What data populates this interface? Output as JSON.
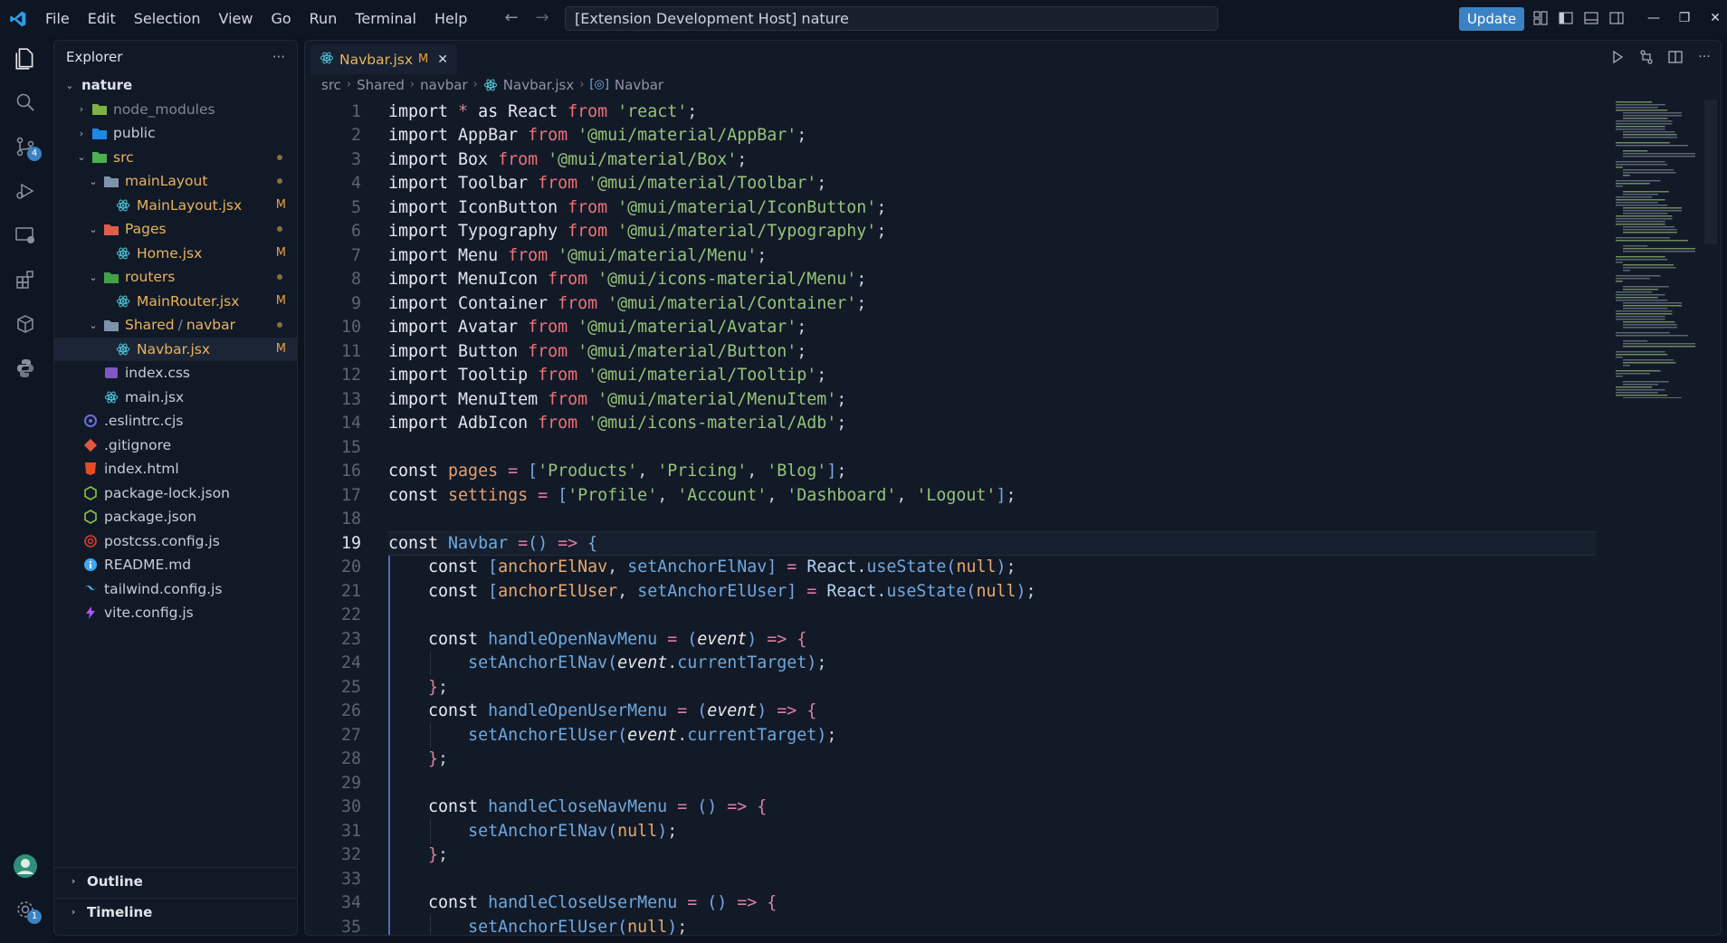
{
  "menu": [
    "File",
    "Edit",
    "Selection",
    "View",
    "Go",
    "Run",
    "Terminal",
    "Help"
  ],
  "command_center": "[Extension Development Host] nature",
  "update_label": "Update",
  "activity": {
    "source_control_badge": "4",
    "settings_badge": "1"
  },
  "explorer": {
    "title": "Explorer",
    "more": "···",
    "root": "nature",
    "items": [
      {
        "label": "node_modules",
        "depth": 1,
        "kind": "folder",
        "state": "collapsed",
        "color": "dim",
        "icon": "node-folder-icon"
      },
      {
        "label": "public",
        "depth": 1,
        "kind": "folder",
        "state": "collapsed",
        "color": "norm",
        "icon": "public-folder-icon"
      },
      {
        "label": "src",
        "depth": 1,
        "kind": "folder",
        "state": "expanded",
        "color": "mod",
        "icon": "src-folder-icon",
        "dot": true
      },
      {
        "label": "mainLayout",
        "depth": 2,
        "kind": "folder",
        "state": "expanded",
        "color": "mod",
        "icon": "folder-icon",
        "dot": true
      },
      {
        "label": "MainLayout.jsx",
        "depth": 3,
        "kind": "file",
        "color": "mod",
        "icon": "react-icon",
        "git": "M"
      },
      {
        "label": "Pages",
        "depth": 2,
        "kind": "folder",
        "state": "expanded",
        "color": "mod",
        "icon": "pages-folder-icon",
        "dot": true
      },
      {
        "label": "Home.jsx",
        "depth": 3,
        "kind": "file",
        "color": "mod",
        "icon": "react-icon",
        "git": "M"
      },
      {
        "label": "routers",
        "depth": 2,
        "kind": "folder",
        "state": "expanded",
        "color": "mod",
        "icon": "routers-folder-icon",
        "dot": true
      },
      {
        "label": "MainRouter.jsx",
        "depth": 3,
        "kind": "file",
        "color": "mod",
        "icon": "react-icon",
        "git": "M"
      },
      {
        "label": "Shared",
        "label2": "navbar",
        "depth": 2,
        "kind": "folder",
        "state": "expanded",
        "color": "mod",
        "icon": "folder-icon",
        "dot": true
      },
      {
        "label": "Navbar.jsx",
        "depth": 3,
        "kind": "file",
        "color": "mod",
        "icon": "react-icon",
        "git": "M",
        "selected": true
      },
      {
        "label": "index.css",
        "depth": 2,
        "kind": "file",
        "color": "norm",
        "icon": "css-icon"
      },
      {
        "label": "main.jsx",
        "depth": 2,
        "kind": "file",
        "color": "norm",
        "icon": "react-icon"
      },
      {
        "label": ".eslintrc.cjs",
        "depth": 1,
        "kind": "file",
        "color": "norm",
        "icon": "eslint-icon"
      },
      {
        "label": ".gitignore",
        "depth": 1,
        "kind": "file",
        "color": "norm",
        "icon": "git-icon"
      },
      {
        "label": "index.html",
        "depth": 1,
        "kind": "file",
        "color": "norm",
        "icon": "html-icon"
      },
      {
        "label": "package-lock.json",
        "depth": 1,
        "kind": "file",
        "color": "norm",
        "icon": "npm-icon"
      },
      {
        "label": "package.json",
        "depth": 1,
        "kind": "file",
        "color": "norm",
        "icon": "npm-icon"
      },
      {
        "label": "postcss.config.js",
        "depth": 1,
        "kind": "file",
        "color": "norm",
        "icon": "postcss-icon"
      },
      {
        "label": "README.md",
        "depth": 1,
        "kind": "file",
        "color": "norm",
        "icon": "info-icon"
      },
      {
        "label": "tailwind.config.js",
        "depth": 1,
        "kind": "file",
        "color": "norm",
        "icon": "tailwind-icon"
      },
      {
        "label": "vite.config.js",
        "depth": 1,
        "kind": "file",
        "color": "norm",
        "icon": "vite-icon"
      }
    ],
    "outline": "Outline",
    "timeline": "Timeline"
  },
  "tab": {
    "label": "Navbar.jsx",
    "status": "M"
  },
  "breadcrumbs": [
    "src",
    "Shared",
    "navbar",
    "Navbar.jsx",
    "Navbar"
  ],
  "active_line": 19,
  "code_lines": [
    [
      [
        "kw2",
        "import "
      ],
      [
        "op",
        "* "
      ],
      [
        "kw2",
        "as "
      ],
      [
        "id",
        "React "
      ],
      [
        "kw",
        "from "
      ],
      [
        "str",
        "'react'"
      ],
      [
        "pun",
        ";"
      ]
    ],
    [
      [
        "kw2",
        "import "
      ],
      [
        "id",
        "AppBar "
      ],
      [
        "kw",
        "from "
      ],
      [
        "str",
        "'@mui/material/AppBar'"
      ],
      [
        "pun",
        ";"
      ]
    ],
    [
      [
        "kw2",
        "import "
      ],
      [
        "id",
        "Box "
      ],
      [
        "kw",
        "from "
      ],
      [
        "str",
        "'@mui/material/Box'"
      ],
      [
        "pun",
        ";"
      ]
    ],
    [
      [
        "kw2",
        "import "
      ],
      [
        "id",
        "Toolbar "
      ],
      [
        "kw",
        "from "
      ],
      [
        "str",
        "'@mui/material/Toolbar'"
      ],
      [
        "pun",
        ";"
      ]
    ],
    [
      [
        "kw2",
        "import "
      ],
      [
        "id",
        "IconButton "
      ],
      [
        "kw",
        "from "
      ],
      [
        "str",
        "'@mui/material/IconButton'"
      ],
      [
        "pun",
        ";"
      ]
    ],
    [
      [
        "kw2",
        "import "
      ],
      [
        "id",
        "Typography "
      ],
      [
        "kw",
        "from "
      ],
      [
        "str",
        "'@mui/material/Typography'"
      ],
      [
        "pun",
        ";"
      ]
    ],
    [
      [
        "kw2",
        "import "
      ],
      [
        "id",
        "Menu "
      ],
      [
        "kw",
        "from "
      ],
      [
        "str",
        "'@mui/material/Menu'"
      ],
      [
        "pun",
        ";"
      ]
    ],
    [
      [
        "kw2",
        "import "
      ],
      [
        "id",
        "MenuIcon "
      ],
      [
        "kw",
        "from "
      ],
      [
        "str",
        "'@mui/icons-material/Menu'"
      ],
      [
        "pun",
        ";"
      ]
    ],
    [
      [
        "kw2",
        "import "
      ],
      [
        "id",
        "Container "
      ],
      [
        "kw",
        "from "
      ],
      [
        "str",
        "'@mui/material/Container'"
      ],
      [
        "pun",
        ";"
      ]
    ],
    [
      [
        "kw2",
        "import "
      ],
      [
        "id",
        "Avatar "
      ],
      [
        "kw",
        "from "
      ],
      [
        "str",
        "'@mui/material/Avatar'"
      ],
      [
        "pun",
        ";"
      ]
    ],
    [
      [
        "kw2",
        "import "
      ],
      [
        "id",
        "Button "
      ],
      [
        "kw",
        "from "
      ],
      [
        "str",
        "'@mui/material/Button'"
      ],
      [
        "pun",
        ";"
      ]
    ],
    [
      [
        "kw2",
        "import "
      ],
      [
        "id",
        "Tooltip "
      ],
      [
        "kw",
        "from "
      ],
      [
        "str",
        "'@mui/material/Tooltip'"
      ],
      [
        "pun",
        ";"
      ]
    ],
    [
      [
        "kw2",
        "import "
      ],
      [
        "id",
        "MenuItem "
      ],
      [
        "kw",
        "from "
      ],
      [
        "str",
        "'@mui/material/MenuItem'"
      ],
      [
        "pun",
        ";"
      ]
    ],
    [
      [
        "kw2",
        "import "
      ],
      [
        "id",
        "AdbIcon "
      ],
      [
        "kw",
        "from "
      ],
      [
        "str",
        "'@mui/icons-material/Adb'"
      ],
      [
        "pun",
        ";"
      ]
    ],
    [],
    [
      [
        "kw2",
        "const "
      ],
      [
        "cst",
        "pages "
      ],
      [
        "op",
        "= "
      ],
      [
        "br",
        "["
      ],
      [
        "str",
        "'Products'"
      ],
      [
        "pun",
        ", "
      ],
      [
        "str",
        "'Pricing'"
      ],
      [
        "pun",
        ", "
      ],
      [
        "str",
        "'Blog'"
      ],
      [
        "br",
        "]"
      ],
      [
        "pun",
        ";"
      ]
    ],
    [
      [
        "kw2",
        "const "
      ],
      [
        "cst",
        "settings "
      ],
      [
        "op",
        "= "
      ],
      [
        "br",
        "["
      ],
      [
        "str",
        "'Profile'"
      ],
      [
        "pun",
        ", "
      ],
      [
        "str",
        "'Account'"
      ],
      [
        "pun",
        ", "
      ],
      [
        "str",
        "'Dashboard'"
      ],
      [
        "pun",
        ", "
      ],
      [
        "str",
        "'Logout'"
      ],
      [
        "br",
        "]"
      ],
      [
        "pun",
        ";"
      ]
    ],
    [],
    [
      [
        "kw2",
        "const "
      ],
      [
        "fn",
        "Navbar "
      ],
      [
        "op",
        "="
      ],
      [
        "br",
        "() "
      ],
      [
        "op",
        "=> "
      ],
      [
        "br",
        "{"
      ]
    ],
    [
      [
        "pun",
        "    "
      ],
      [
        "kw2",
        "const "
      ],
      [
        "br",
        "["
      ],
      [
        "var",
        "anchorElNav"
      ],
      [
        "pun",
        ", "
      ],
      [
        "fn",
        "setAnchorElNav"
      ],
      [
        "br",
        "] "
      ],
      [
        "op",
        "= "
      ],
      [
        "react",
        "React"
      ],
      [
        "pun",
        "."
      ],
      [
        "fn",
        "useState"
      ],
      [
        "br",
        "("
      ],
      [
        "null",
        "null"
      ],
      [
        "br",
        ")"
      ],
      [
        "pun",
        ";"
      ]
    ],
    [
      [
        "pun",
        "    "
      ],
      [
        "kw2",
        "const "
      ],
      [
        "br",
        "["
      ],
      [
        "var",
        "anchorElUser"
      ],
      [
        "pun",
        ", "
      ],
      [
        "fn",
        "setAnchorElUser"
      ],
      [
        "br",
        "] "
      ],
      [
        "op",
        "= "
      ],
      [
        "react",
        "React"
      ],
      [
        "pun",
        "."
      ],
      [
        "fn",
        "useState"
      ],
      [
        "br",
        "("
      ],
      [
        "null",
        "null"
      ],
      [
        "br",
        ")"
      ],
      [
        "pun",
        ";"
      ]
    ],
    [],
    [
      [
        "pun",
        "    "
      ],
      [
        "kw2",
        "const "
      ],
      [
        "fn",
        "handleOpenNavMenu "
      ],
      [
        "op",
        "= "
      ],
      [
        "br",
        "("
      ],
      [
        "param",
        "event"
      ],
      [
        "br",
        ") "
      ],
      [
        "op",
        "=> "
      ],
      [
        "op",
        "{"
      ]
    ],
    [
      [
        "pun",
        "        "
      ],
      [
        "fn",
        "setAnchorElNav"
      ],
      [
        "br",
        "("
      ],
      [
        "param",
        "event"
      ],
      [
        "pun",
        "."
      ],
      [
        "fn",
        "currentTarget"
      ],
      [
        "br",
        ")"
      ],
      [
        "pun",
        ";"
      ]
    ],
    [
      [
        "pun",
        "    "
      ],
      [
        "op",
        "}"
      ],
      [
        "pun",
        ";"
      ]
    ],
    [
      [
        "pun",
        "    "
      ],
      [
        "kw2",
        "const "
      ],
      [
        "fn",
        "handleOpenUserMenu "
      ],
      [
        "op",
        "= "
      ],
      [
        "br",
        "("
      ],
      [
        "param",
        "event"
      ],
      [
        "br",
        ") "
      ],
      [
        "op",
        "=> "
      ],
      [
        "op",
        "{"
      ]
    ],
    [
      [
        "pun",
        "        "
      ],
      [
        "fn",
        "setAnchorElUser"
      ],
      [
        "br",
        "("
      ],
      [
        "param",
        "event"
      ],
      [
        "pun",
        "."
      ],
      [
        "fn",
        "currentTarget"
      ],
      [
        "br",
        ")"
      ],
      [
        "pun",
        ";"
      ]
    ],
    [
      [
        "pun",
        "    "
      ],
      [
        "op",
        "}"
      ],
      [
        "pun",
        ";"
      ]
    ],
    [],
    [
      [
        "pun",
        "    "
      ],
      [
        "kw2",
        "const "
      ],
      [
        "fn",
        "handleCloseNavMenu "
      ],
      [
        "op",
        "= "
      ],
      [
        "br",
        "() "
      ],
      [
        "op",
        "=> "
      ],
      [
        "op",
        "{"
      ]
    ],
    [
      [
        "pun",
        "        "
      ],
      [
        "fn",
        "setAnchorElNav"
      ],
      [
        "br",
        "("
      ],
      [
        "null",
        "null"
      ],
      [
        "br",
        ")"
      ],
      [
        "pun",
        ";"
      ]
    ],
    [
      [
        "pun",
        "    "
      ],
      [
        "op",
        "}"
      ],
      [
        "pun",
        ";"
      ]
    ],
    [],
    [
      [
        "pun",
        "    "
      ],
      [
        "kw2",
        "const "
      ],
      [
        "fn",
        "handleCloseUserMenu "
      ],
      [
        "op",
        "= "
      ],
      [
        "br",
        "() "
      ],
      [
        "op",
        "=> "
      ],
      [
        "op",
        "{"
      ]
    ],
    [
      [
        "pun",
        "        "
      ],
      [
        "fn",
        "setAnchorElUser"
      ],
      [
        "br",
        "("
      ],
      [
        "null",
        "null"
      ],
      [
        "br",
        ")"
      ],
      [
        "pun",
        ";"
      ]
    ]
  ],
  "colors": {
    "accent": "#3b82c4",
    "modified": "#e8b35d",
    "string": "#97c279",
    "keyword": "#f07178",
    "function": "#6fa8dc"
  }
}
